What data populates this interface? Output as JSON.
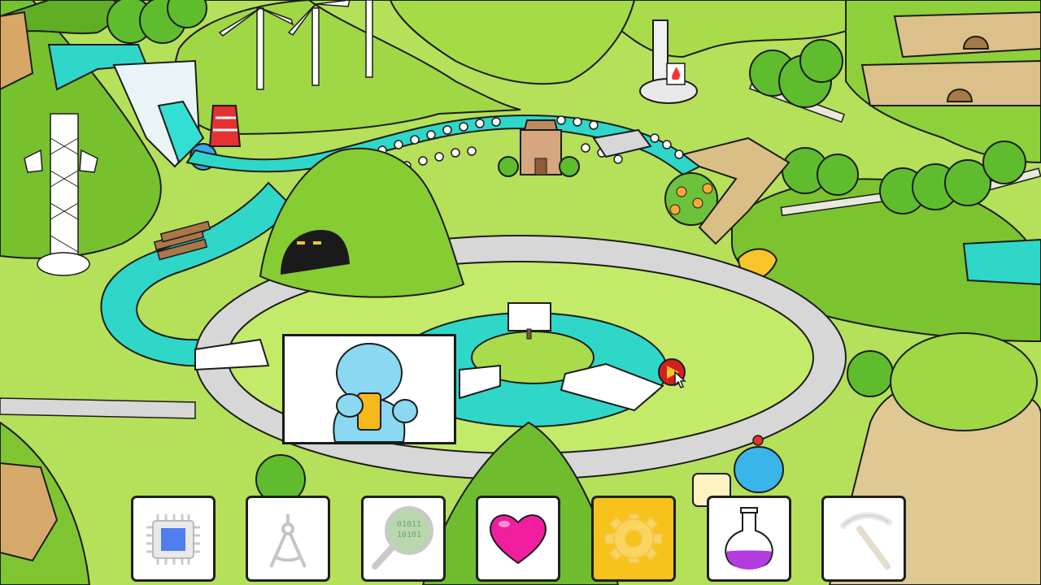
{
  "game": {
    "scene": "world-map",
    "colors": {
      "grass_light": "#c4ea6a",
      "grass": "#9fd844",
      "grass_dark": "#6fb82a",
      "water": "#2fd7c9",
      "road": "#d9d9d9",
      "outline": "#1c1c1c",
      "active_slot": "#f7c21b",
      "heart": "#f21ea0",
      "potion": "#b23ce0"
    }
  },
  "toolbar": {
    "slots": [
      {
        "id": "chip",
        "icon": "cpu-chip-icon",
        "active": false
      },
      {
        "id": "compass",
        "icon": "drafting-compass-icon",
        "active": false
      },
      {
        "id": "binary",
        "icon": "binary-magnifier-icon",
        "active": false
      },
      {
        "id": "heart",
        "icon": "heart-icon",
        "active": false
      },
      {
        "id": "gear",
        "icon": "gear-icon",
        "active": true
      },
      {
        "id": "potion",
        "icon": "flask-potion-icon",
        "active": false
      },
      {
        "id": "pickaxe",
        "icon": "pickaxe-icon",
        "active": false
      }
    ]
  },
  "sign": {
    "icon": "character-holding-card-icon"
  }
}
